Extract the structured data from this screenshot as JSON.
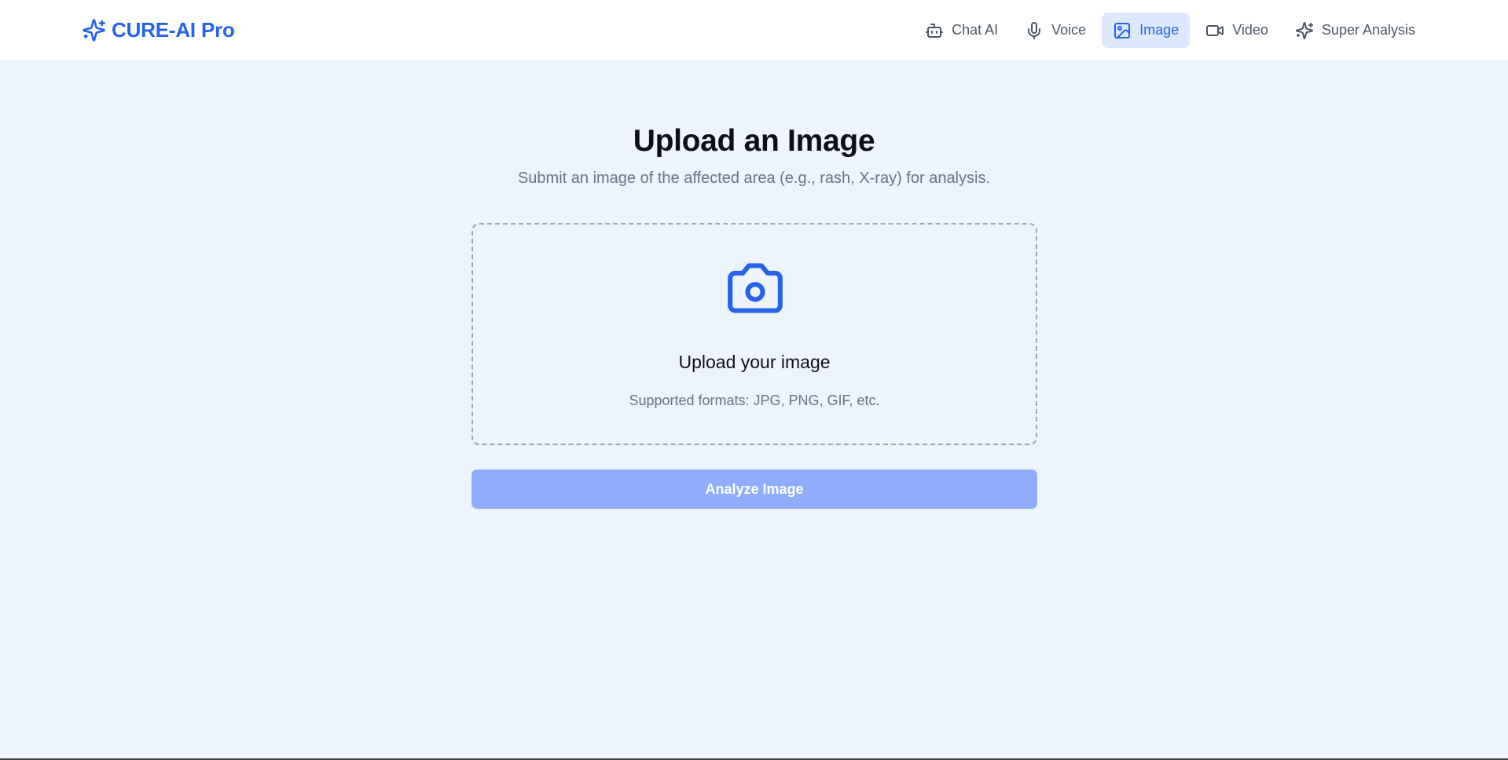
{
  "app": {
    "brand": "CURE-AI Pro",
    "brand_icon": "sparkles-icon",
    "accent_color": "#2563eb"
  },
  "nav": {
    "items": [
      {
        "label": "Chat AI",
        "icon": "robot-icon",
        "active": false
      },
      {
        "label": "Voice",
        "icon": "microphone-icon",
        "active": false
      },
      {
        "label": "Image",
        "icon": "image-icon",
        "active": true
      },
      {
        "label": "Video",
        "icon": "video-camera-icon",
        "active": false
      },
      {
        "label": "Super Analysis",
        "icon": "sparkles-icon",
        "active": false
      }
    ]
  },
  "main": {
    "title": "Upload an Image",
    "subtitle": "Submit an image of the affected area (e.g., rash, X-ray) for analysis."
  },
  "upload": {
    "icon": "camera-icon",
    "title": "Upload your image",
    "hint": "Supported formats: JPG, PNG, GIF, etc."
  },
  "actions": {
    "analyze_label": "Analyze Image",
    "analyze_disabled": true,
    "analyze_color": "#8fadfa"
  }
}
